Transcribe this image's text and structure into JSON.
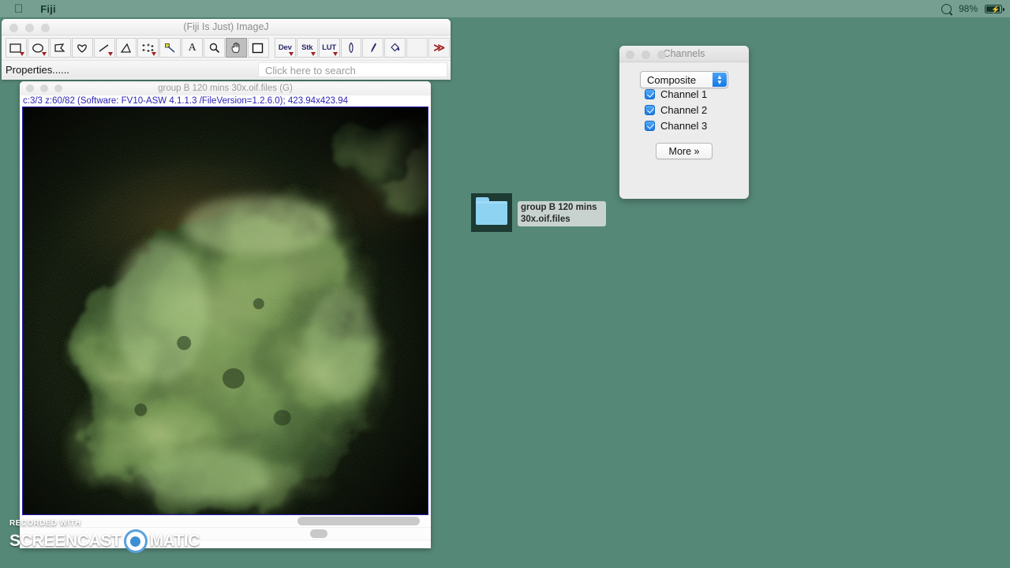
{
  "menubar": {
    "apple_icon": "apple-icon",
    "app_name": "Fiji",
    "search_icon": "spotlight-search-icon",
    "battery_percent": "98%",
    "battery_icon": "battery-charging-icon"
  },
  "fiji_window": {
    "title": "(Fiji Is Just) ImageJ",
    "traffic_lights": [
      "close",
      "minimize",
      "zoom"
    ],
    "tools": [
      {
        "name": "rectangle-tool",
        "glyph": "rect",
        "has_dropdown": true,
        "selected": false
      },
      {
        "name": "oval-tool",
        "glyph": "oval",
        "has_dropdown": true,
        "selected": false
      },
      {
        "name": "polygon-tool",
        "glyph": "polygon",
        "has_dropdown": false,
        "selected": false
      },
      {
        "name": "freehand-tool",
        "glyph": "freehand",
        "has_dropdown": false,
        "selected": false
      },
      {
        "name": "line-tool",
        "glyph": "line",
        "has_dropdown": true,
        "selected": false
      },
      {
        "name": "angle-tool",
        "glyph": "angle",
        "has_dropdown": false,
        "selected": false
      },
      {
        "name": "point-tool",
        "glyph": "point",
        "has_dropdown": true,
        "selected": false
      },
      {
        "name": "wand-tool",
        "glyph": "wand",
        "has_dropdown": false,
        "selected": false
      },
      {
        "name": "text-tool",
        "glyph": "A",
        "has_dropdown": false,
        "selected": false
      },
      {
        "name": "magnifier-tool",
        "glyph": "zoom",
        "has_dropdown": false,
        "selected": false
      },
      {
        "name": "hand-tool",
        "glyph": "hand",
        "has_dropdown": false,
        "selected": true
      },
      {
        "name": "color-picker-tool",
        "glyph": "square",
        "has_dropdown": false,
        "selected": false
      }
    ],
    "text_tools": [
      {
        "name": "dev-menu-button",
        "label": "Dev",
        "has_dropdown": true
      },
      {
        "name": "stack-menu-button",
        "label": "Stk",
        "has_dropdown": true
      },
      {
        "name": "lut-menu-button",
        "label": "LUT",
        "has_dropdown": true
      }
    ],
    "draw_tools": [
      {
        "name": "pencil-tool",
        "glyph": "pencil"
      },
      {
        "name": "brush-tool",
        "glyph": "brush"
      },
      {
        "name": "flood-fill-tool",
        "glyph": "bucket"
      }
    ],
    "blank_tool": {
      "name": "empty-tool-slot"
    },
    "more_tools": {
      "name": "more-tools-button",
      "label": "≫"
    },
    "status_text": "Properties......",
    "search_placeholder": "Click here to search"
  },
  "image_window": {
    "title": "group B 120 mins 30x.oif.files (G)",
    "info_line": "c:3/3 z:60/82 (Software: FV10-ASW 4.1.1.3 /FileVersion=1.2.6.0); 423.94x423.94",
    "channel_current": 3,
    "channel_total": 3,
    "slice_current": 60,
    "slice_total": 82,
    "dimensions": "423.94x423.94",
    "software": "FV10-ASW 4.1.1.3",
    "file_version": "1.2.6.0",
    "sliders": [
      {
        "name": "z-slice-slider",
        "knob_left_pct": 70,
        "knob_width_pct": 30
      },
      {
        "name": "channel-slider",
        "knob_left_pct": 72,
        "knob_width_pct": 4
      }
    ]
  },
  "channels_window": {
    "title": "Channels",
    "mode_selected": "Composite",
    "channels": [
      {
        "label": "Channel 1",
        "checked": true
      },
      {
        "label": "Channel 2",
        "checked": true
      },
      {
        "label": "Channel 3",
        "checked": true
      }
    ],
    "more_label": "More »"
  },
  "desktop": {
    "background_color": "#568878",
    "icon": {
      "name": "folder-icon",
      "label": "group B 120 mins 30x.oif.files"
    }
  },
  "watermark": {
    "line1": "RECORDED WITH",
    "line2a": "SCREENCAST",
    "line2b": "MATIC"
  },
  "colors": {
    "desktop": "#568878",
    "info_text": "#2a1fb5",
    "accent_blue": "#1a7de9",
    "more_tools_red": "#a02020"
  }
}
